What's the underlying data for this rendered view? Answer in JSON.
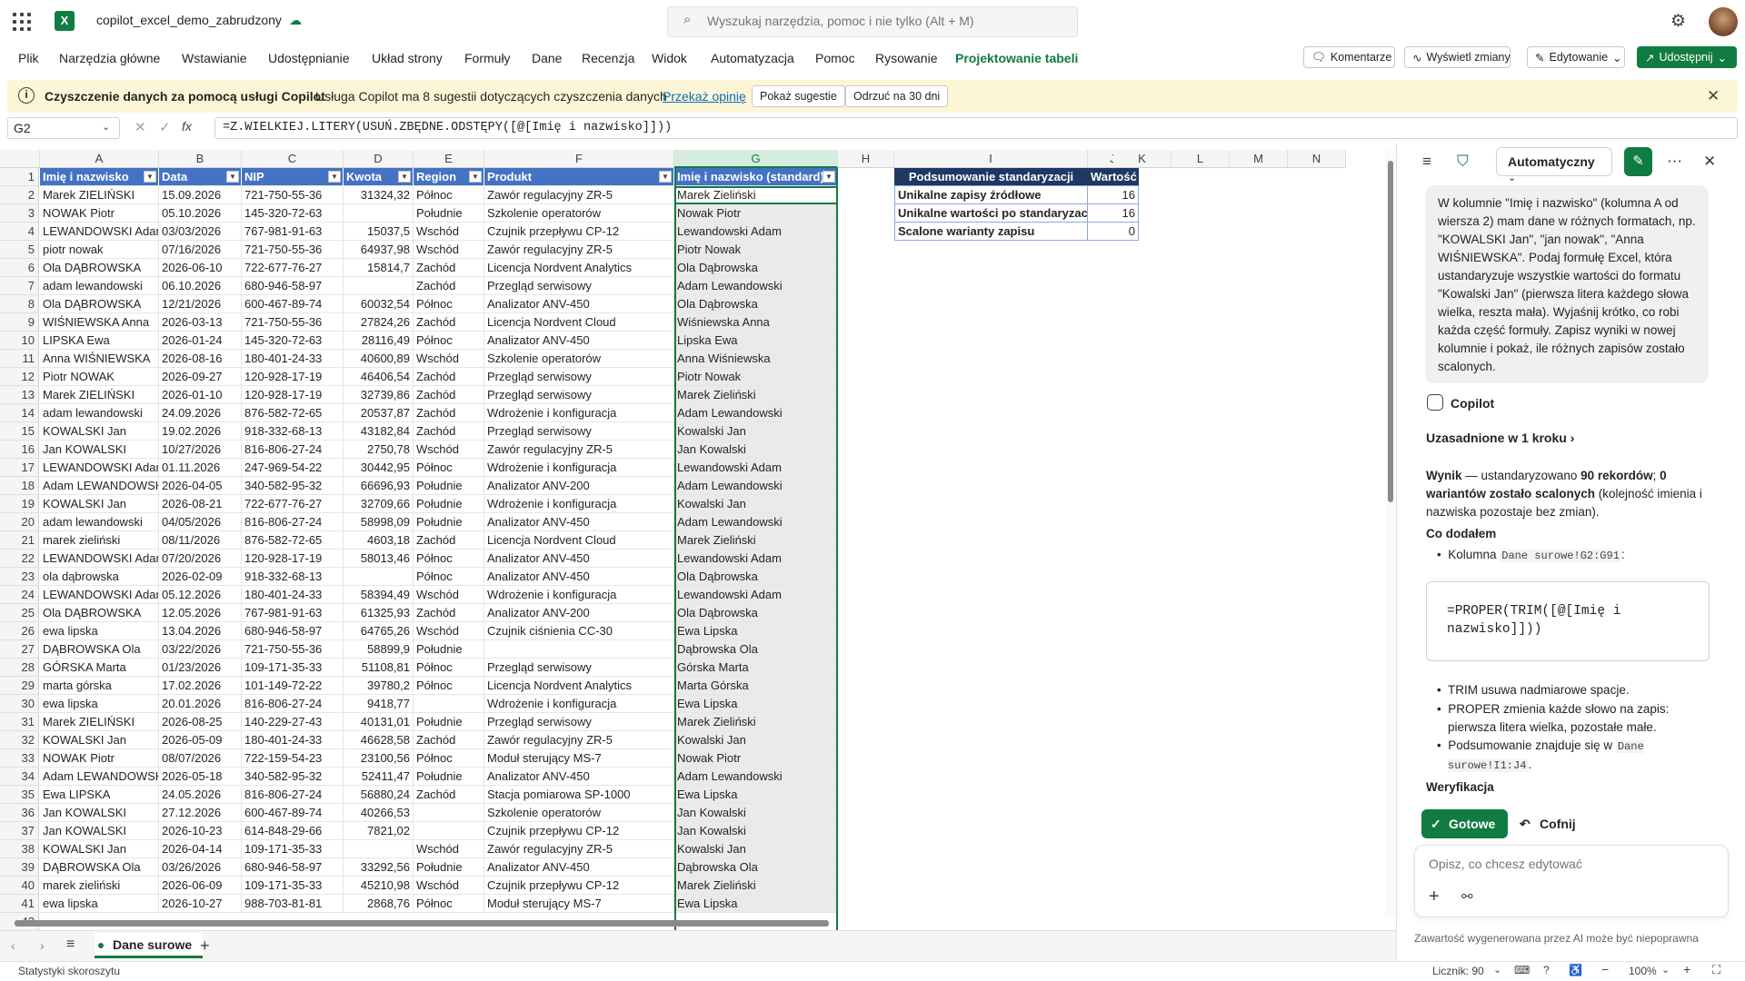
{
  "app": {
    "title": "copilot_excel_demo_zabrudzony"
  },
  "search": {
    "placeholder": "Wyszukaj narzędzia, pomoc i nie tylko (Alt + M)"
  },
  "menu": {
    "items": [
      "Plik",
      "Narzędzia główne",
      "Wstawianie",
      "Udostępnianie",
      "Układ strony",
      "Formuły",
      "Dane",
      "Recenzja",
      "Widok",
      "Automatyzacja",
      "Pomoc",
      "Rysowanie",
      "Projektowanie tabeli"
    ],
    "active": "Projektowanie tabeli",
    "comments": "Komentarze",
    "show_changes": "Wyświetl zmiany",
    "editing": "Edytowanie",
    "share": "Udostępnij"
  },
  "banner": {
    "title": "Czyszczenie danych za pomocą usługi Copilot",
    "text": "Usługa Copilot ma 8 sugestii dotyczących czyszczenia danych",
    "link": "Przekaż opinię",
    "show_btn": "Pokaż sugestie",
    "dismiss_btn": "Odrzuć na 30 dni"
  },
  "formula_bar": {
    "name_box": "G2",
    "formula": "=Z.WIELKIEJ.LITERY(USUŃ.ZBĘDNE.ODSTĘPY([@[Imię i nazwisko]]))"
  },
  "columns": [
    "A",
    "B",
    "C",
    "D",
    "E",
    "F",
    "G",
    "H",
    "I",
    "J",
    "K",
    "L",
    "M",
    "N"
  ],
  "table": {
    "headers": [
      "Imię i nazwisko",
      "Data",
      "NIP",
      "Kwota",
      "Region",
      "Produkt",
      "Imię i nazwisko (standard)"
    ],
    "rows": [
      [
        "Marek ZIELIŃSKI",
        "15.09.2026",
        "721-750-55-36",
        "31324,32",
        "Północ",
        "Zawór regulacyjny ZR-5",
        "Marek Zieliński"
      ],
      [
        "NOWAK Piotr",
        "05.10.2026",
        "145-320-72-63",
        "",
        "Południe",
        "Szkolenie operatorów",
        "Nowak Piotr"
      ],
      [
        "LEWANDOWSKI Adam",
        "03/03/2026",
        "767-981-91-63",
        "15037,5",
        "Wschód",
        "Czujnik przepływu CP-12",
        "Lewandowski Adam"
      ],
      [
        "piotr nowak",
        "07/16/2026",
        "721-750-55-36",
        "64937,98",
        "Wschód",
        "Zawór regulacyjny ZR-5",
        "Piotr Nowak"
      ],
      [
        "Ola DĄBROWSKA",
        "2026-06-10",
        "722-677-76-27",
        "15814,7",
        "Zachód",
        "Licencja Nordvent Analytics",
        "Ola Dąbrowska"
      ],
      [
        "adam lewandowski",
        "06.10.2026",
        "680-946-58-97",
        "",
        "Zachód",
        "Przegląd serwisowy",
        "Adam Lewandowski"
      ],
      [
        "Ola DĄBROWSKA",
        "12/21/2026",
        "600-467-89-74",
        "60032,54",
        "Północ",
        "Analizator ANV-450",
        "Ola Dąbrowska"
      ],
      [
        "WIŚNIEWSKA Anna",
        "2026-03-13",
        "721-750-55-36",
        "27824,26",
        "Zachód",
        "Licencja Nordvent Cloud",
        "Wiśniewska Anna"
      ],
      [
        "LIPSKA Ewa",
        "2026-01-24",
        "145-320-72-63",
        "28116,49",
        "Północ",
        "Analizator ANV-450",
        "Lipska Ewa"
      ],
      [
        "Anna WIŚNIEWSKA",
        "2026-08-16",
        "180-401-24-33",
        "40600,89",
        "Wschód",
        "Szkolenie operatorów",
        "Anna Wiśniewska"
      ],
      [
        "Piotr NOWAK",
        "2026-09-27",
        "120-928-17-19",
        "46406,54",
        "Zachód",
        "Przegląd serwisowy",
        "Piotr Nowak"
      ],
      [
        "Marek ZIELIŃSKI",
        "2026-01-10",
        "120-928-17-19",
        "32739,86",
        "Zachód",
        "Przegląd serwisowy",
        "Marek Zieliński"
      ],
      [
        "adam lewandowski",
        "24.09.2026",
        "876-582-72-65",
        "20537,87",
        "Zachód",
        "Wdrożenie i konfiguracja",
        "Adam Lewandowski"
      ],
      [
        "KOWALSKI Jan",
        "19.02.2026",
        "918-332-68-13",
        "43182,84",
        "Zachód",
        "Przegląd serwisowy",
        "Kowalski Jan"
      ],
      [
        "Jan KOWALSKI",
        "10/27/2026",
        "816-806-27-24",
        "2750,78",
        "Wschód",
        "Zawór regulacyjny ZR-5",
        "Jan Kowalski"
      ],
      [
        "LEWANDOWSKI Adam",
        "01.11.2026",
        "247-969-54-22",
        "30442,95",
        "Północ",
        "Wdrożenie i konfiguracja",
        "Lewandowski Adam"
      ],
      [
        "Adam LEWANDOWSKI",
        "2026-04-05",
        "340-582-95-32",
        "66696,93",
        "Południe",
        "Analizator ANV-200",
        "Adam Lewandowski"
      ],
      [
        "KOWALSKI Jan",
        "2026-08-21",
        "722-677-76-27",
        "32709,66",
        "Południe",
        "Wdrożenie i konfiguracja",
        "Kowalski Jan"
      ],
      [
        "adam lewandowski",
        "04/05/2026",
        "816-806-27-24",
        "58998,09",
        "Południe",
        "Analizator ANV-450",
        "Adam Lewandowski"
      ],
      [
        "marek zieliński",
        "08/11/2026",
        "876-582-72-65",
        "4603,18",
        "Zachód",
        "Licencja Nordvent Cloud",
        "Marek Zieliński"
      ],
      [
        "LEWANDOWSKI Adam",
        "07/20/2026",
        "120-928-17-19",
        "58013,46",
        "Północ",
        "Analizator ANV-450",
        "Lewandowski Adam"
      ],
      [
        "ola dąbrowska",
        "2026-02-09",
        "918-332-68-13",
        "",
        "Północ",
        "Analizator ANV-450",
        "Ola Dąbrowska"
      ],
      [
        "LEWANDOWSKI Adam",
        "05.12.2026",
        "180-401-24-33",
        "58394,49",
        "Wschód",
        "Wdrożenie i konfiguracja",
        "Lewandowski Adam"
      ],
      [
        "Ola DĄBROWSKA",
        "12.05.2026",
        "767-981-91-63",
        "61325,93",
        "Zachód",
        "Analizator ANV-200",
        "Ola Dąbrowska"
      ],
      [
        "ewa lipska",
        "13.04.2026",
        "680-946-58-97",
        "64765,26",
        "Wschód",
        "Czujnik ciśnienia CC-30",
        "Ewa Lipska"
      ],
      [
        "DĄBROWSKA Ola",
        "03/22/2026",
        "721-750-55-36",
        "58899,9",
        "Południe",
        "",
        "Dąbrowska Ola"
      ],
      [
        "GÓRSKA Marta",
        "01/23/2026",
        "109-171-35-33",
        "51108,81",
        "Północ",
        "Przegląd serwisowy",
        "Górska Marta"
      ],
      [
        "marta górska",
        "17.02.2026",
        "101-149-72-22",
        "39780,2",
        "Północ",
        "Licencja Nordvent Analytics",
        "Marta Górska"
      ],
      [
        "ewa lipska",
        "20.01.2026",
        "816-806-27-24",
        "9418,77",
        "",
        "Wdrożenie i konfiguracja",
        "Ewa Lipska"
      ],
      [
        "Marek ZIELIŃSKI",
        "2026-08-25",
        "140-229-27-43",
        "40131,01",
        "Południe",
        "Przegląd serwisowy",
        "Marek Zieliński"
      ],
      [
        "KOWALSKI Jan",
        "2026-05-09",
        "180-401-24-33",
        "46628,58",
        "Zachód",
        "Zawór regulacyjny ZR-5",
        "Kowalski Jan"
      ],
      [
        "NOWAK Piotr",
        "08/07/2026",
        "722-159-54-23",
        "23100,56",
        "Północ",
        "Moduł sterujący MS-7",
        "Nowak Piotr"
      ],
      [
        "Adam LEWANDOWSKI",
        "2026-05-18",
        "340-582-95-32",
        "52411,47",
        "Południe",
        "Analizator ANV-450",
        "Adam Lewandowski"
      ],
      [
        "Ewa LIPSKA",
        "24.05.2026",
        "816-806-27-24",
        "56880,24",
        "Zachód",
        "Stacja pomiarowa SP-1000",
        "Ewa Lipska"
      ],
      [
        "Jan KOWALSKI",
        "27.12.2026",
        "600-467-89-74",
        "40266,53",
        "",
        "Szkolenie operatorów",
        "Jan Kowalski"
      ],
      [
        "Jan KOWALSKI",
        "2026-10-23",
        "614-848-29-66",
        "7821,02",
        "",
        "Czujnik przepływu CP-12",
        "Jan Kowalski"
      ],
      [
        "KOWALSKI Jan",
        "2026-04-14",
        "109-171-35-33",
        "",
        "Wschód",
        "Zawór regulacyjny ZR-5",
        "Kowalski Jan"
      ],
      [
        "DĄBROWSKA Ola",
        "03/26/2026",
        "680-946-58-97",
        "33292,56",
        "Południe",
        "Analizator ANV-450",
        "Dąbrowska Ola"
      ],
      [
        "marek zieliński",
        "2026-06-09",
        "109-171-35-33",
        "45210,98",
        "Wschód",
        "Czujnik przepływu CP-12",
        "Marek Zieliński"
      ],
      [
        "ewa lipska",
        "2026-10-27",
        "988-703-81-81",
        "2868,76",
        "Północ",
        "Moduł sterujący MS-7",
        "Ewa Lipska"
      ]
    ]
  },
  "summary": {
    "header_label": "Podsumowanie standaryzacji",
    "header_value": "Wartość",
    "rows": [
      {
        "label": "Unikalne zapisy źródłowe",
        "value": "16"
      },
      {
        "label": "Unikalne wartości po standaryzacji",
        "value": "16"
      },
      {
        "label": "Scalone warianty zapisu",
        "value": "0"
      }
    ]
  },
  "sheet_tabs": {
    "active": "Dane surowe"
  },
  "status": {
    "left": "Statystyki skoroszytu",
    "count": "Licznik: 90",
    "zoom": "100%"
  },
  "copilot": {
    "mode": "Automatyczny",
    "prompt": "W kolumnie \"Imię i nazwisko\" (kolumna A od wiersza 2) mam dane w różnych formatach, np. \"KOWALSKI Jan\", \"jan nowak\", \"Anna WIŚNIEWSKA\". Podaj formułę Excel, która ustandaryzuje wszystkie wartości do formatu \"Kowalski Jan\" (pierwsza litera każdego słowa wielka, reszta mała). Wyjaśnij krótko, co robi każda część formuły. Zapisz wyniki w nowej kolumnie i pokaż, ile różnych zapisów zostało scalonych.",
    "name": "Copilot",
    "grounded": "Uzasadnione w 1 kroku",
    "result_lead": "Wynik",
    "result_text1": " — ustandaryzowano ",
    "result_bold1": "90 rekordów",
    "result_text2": "; ",
    "result_bold2": "0 wariantów zostało scalonych",
    "result_text3": " (kolejność imienia i nazwiska pozostaje bez zmian).",
    "added_heading": "Co dodałem",
    "added_item_prefix": "Kolumna ",
    "added_item_code": "Dane surowe!G2:G91",
    "added_item_suffix": ":",
    "code": "=PROPER(TRIM([@[Imię i nazwisko]]))",
    "bullet1_code": "TRIM",
    "bullet1_text": " usuwa nadmiarowe spacje.",
    "bullet2_code": "PROPER",
    "bullet2_text": " zmienia każde słowo na zapis: pierwsza litera wielka, pozostałe małe.",
    "bullet3_text": "Podsumowanie znajduje się w ",
    "bullet3_code": "Dane surowe!I1:J4",
    "bullet3_suffix": ".",
    "verify_heading": "Weryfikacja",
    "done_btn": "Gotowe",
    "undo_btn": "Cofnij",
    "composer_placeholder": "Opisz, co chcesz edytować",
    "disclaimer": "Zawartość wygenerowana przez AI może być niepoprawna"
  }
}
